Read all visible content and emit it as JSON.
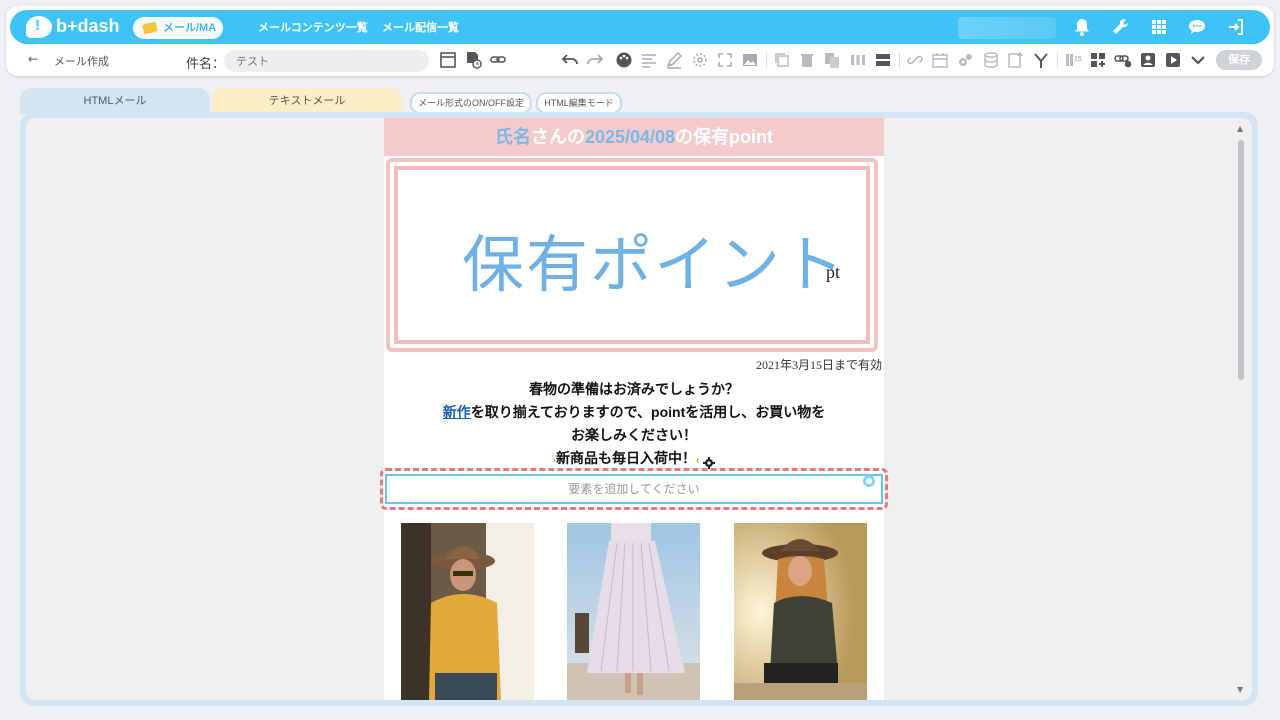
{
  "app": {
    "logo_text": "b+dash"
  },
  "nav": {
    "mail_ma": "メール/MA",
    "links": [
      "メールコンテンツ一覧",
      "メール配信一覧"
    ]
  },
  "toolbar": {
    "back_icon": "arrow-left-icon",
    "page_label": "メール作成",
    "subject_label": "件名：",
    "subject_value": "テスト",
    "save_label": "保存"
  },
  "tabs": {
    "html": "HTMLメール",
    "text": "テキストメール",
    "onoff": "メール形式のON/OFF設定",
    "html_mode": "HTML編集モード"
  },
  "email": {
    "header_name": "氏名",
    "header_san": "さんの",
    "header_date": "2025/04/08",
    "header_suffix": "の保有point",
    "points_title": "保有ポイント",
    "points_unit": "pt",
    "valid_note": "2021年3月15日まで有効",
    "line1": "春物の準備はお済みでしょうか？",
    "line2_link": "新作",
    "line2_rest": "を取り揃えておりますので、pointを活用し、お買い物を",
    "line3": "お楽しみください！",
    "line4": "新商品も毎日入荷中！",
    "add_placeholder": "要素を追加してください"
  },
  "colors": {
    "nav": "#3fc3f5",
    "accent_blue": "#6fb1e4",
    "pink_header": "#f3cbcb",
    "html_tab": "#d4e4f1",
    "text_tab": "#fbeec6"
  }
}
